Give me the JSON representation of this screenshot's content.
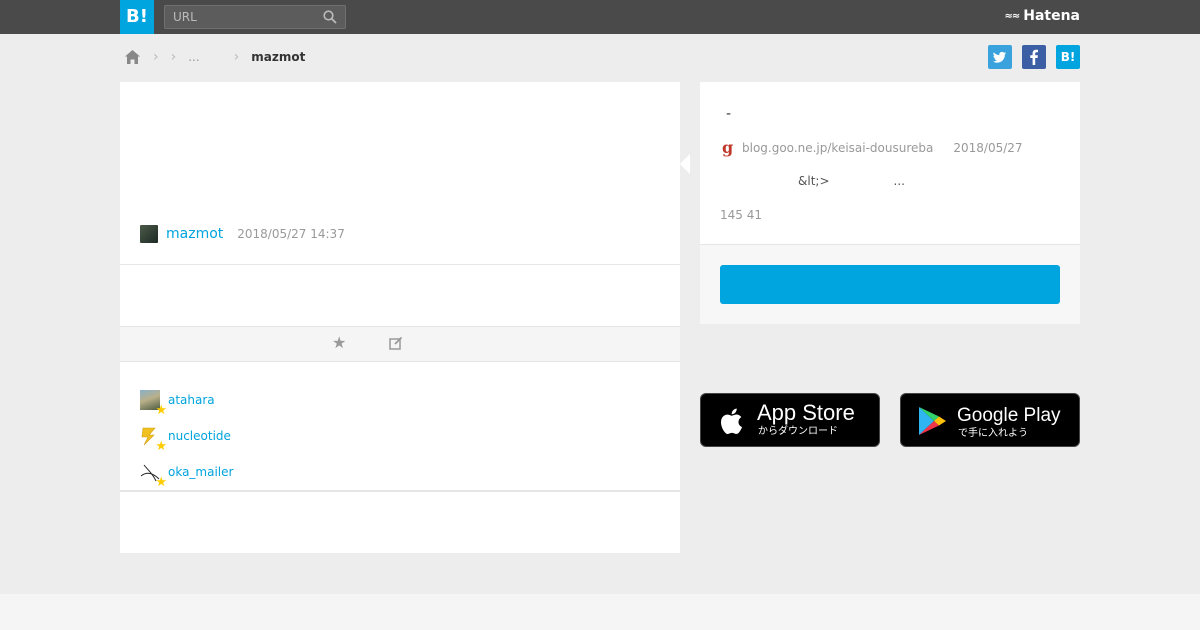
{
  "header": {
    "logo": "B!",
    "search_placeholder": "URL",
    "brand": "Hatena",
    "brand_mark": "≈≈"
  },
  "breadcrumb": {
    "middle": "...",
    "current": "mazmot"
  },
  "share": {
    "twitter": "t",
    "facebook": "f",
    "hatena": "B!"
  },
  "bookmark": {
    "user": "mazmot",
    "timestamp": "2018/05/27 14:37"
  },
  "star_users": [
    {
      "name": "atahara"
    },
    {
      "name": "nucleotide"
    },
    {
      "name": "oka_mailer"
    }
  ],
  "entry": {
    "title": "-",
    "site_icon": "g",
    "domain": "blog.goo.ne.jp/keisai-dousureba",
    "date": "2018/05/27",
    "description_a": "&lt;>",
    "description_b": "...",
    "counts": "145 41"
  },
  "stores": {
    "apple_name": "App Store",
    "apple_sub": "からダウンロード",
    "google_name": "Google Play",
    "google_sub": "で手に入れよう"
  },
  "colors": {
    "accent": "#00a4de",
    "topbar": "#4a4a4a",
    "star": "#ffcc00"
  }
}
